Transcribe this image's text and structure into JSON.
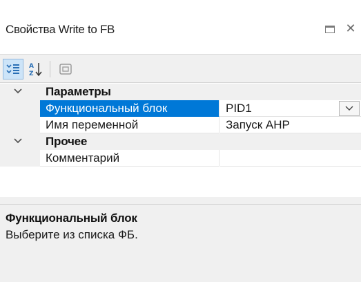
{
  "window": {
    "title": "Свойства Write to FB"
  },
  "toolbar": {
    "buttons": [
      {
        "icon": "categorized-icon",
        "active": true
      },
      {
        "icon": "sort-alphabetical-icon",
        "active": false
      },
      {
        "icon": "property-pages-icon",
        "active": false
      }
    ]
  },
  "grid": {
    "categories": [
      {
        "label": "Параметры",
        "expanded": true,
        "properties": [
          {
            "name": "Функциональный блок",
            "value": "PID1",
            "selected": true,
            "has_dropdown": true
          },
          {
            "name": "Имя переменной",
            "value": "Запуск АНР",
            "selected": false
          }
        ]
      },
      {
        "label": "Прочее",
        "expanded": true,
        "properties": [
          {
            "name": "Комментарий",
            "value": "",
            "selected": false
          }
        ]
      }
    ]
  },
  "description": {
    "title": "Функциональный блок",
    "text": "Выберите из списка ФБ."
  },
  "colors": {
    "selection": "#0078d7",
    "toolbar_bg": "#f0f0f0",
    "active_button_bg": "#cde4f8"
  }
}
